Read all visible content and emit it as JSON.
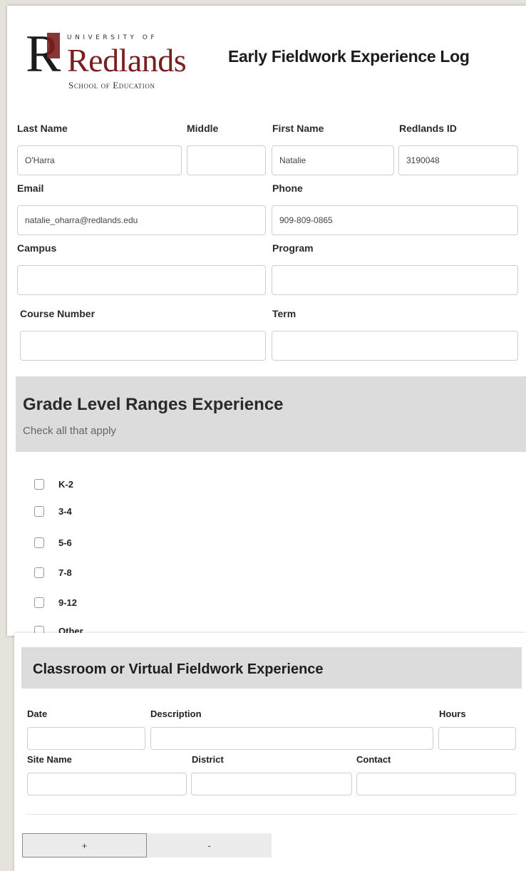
{
  "logo": {
    "r_letter": "R",
    "university_of": "UNIVERSITY OF",
    "name": "Redlands",
    "school": "School of Education"
  },
  "title": "Early Fieldwork Experience Log",
  "fields": {
    "last_name": {
      "label": "Last Name",
      "value": "O'Harra"
    },
    "middle": {
      "label": "Middle",
      "value": ""
    },
    "first_name": {
      "label": "First Name",
      "value": "Natalie"
    },
    "redlands_id": {
      "label": "Redlands ID",
      "value": "3190048"
    },
    "email": {
      "label": "Email",
      "value": "natalie_oharra@redlands.edu"
    },
    "phone": {
      "label": "Phone",
      "value": "909-809-0865"
    },
    "campus": {
      "label": "Campus",
      "value": ""
    },
    "program": {
      "label": "Program",
      "value": ""
    },
    "course_number": {
      "label": "Course Number",
      "value": ""
    },
    "term": {
      "label": "Term",
      "value": ""
    }
  },
  "grade_section": {
    "title": "Grade Level Ranges Experience",
    "subtitle": "Check all that apply",
    "options": [
      {
        "label": "K-2",
        "checked": false
      },
      {
        "label": "3-4",
        "checked": false
      },
      {
        "label": "5-6",
        "checked": false
      },
      {
        "label": "7-8",
        "checked": false
      },
      {
        "label": "9-12",
        "checked": false
      },
      {
        "label": "Other",
        "checked": false
      }
    ]
  },
  "fieldwork_section": {
    "title": "Classroom or Virtual Fieldwork Experience",
    "date_label": "Date",
    "description_label": "Description",
    "hours_label": "Hours",
    "site_name_label": "Site Name",
    "district_label": "District",
    "contact_label": "Contact",
    "add_button": "+",
    "remove_button": "-"
  },
  "colors": {
    "brand": "#7a1f1f",
    "section_bg": "#dcdcdc"
  }
}
